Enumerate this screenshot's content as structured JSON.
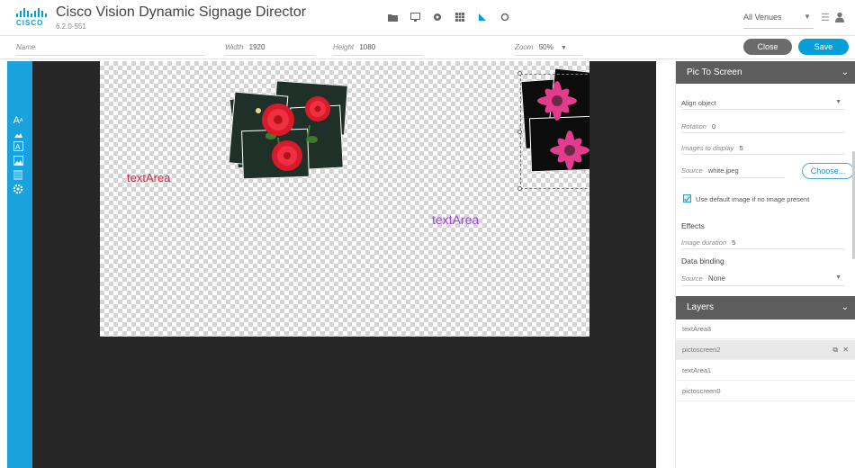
{
  "header": {
    "app_title": "Cisco Vision Dynamic Signage Director",
    "version": "6.2.0-551",
    "logo_word": "CISCO",
    "venue_select": "All Venues",
    "toolbar_icons": [
      "folder-icon",
      "monitor-icon",
      "gear-icon",
      "grid-icon",
      "pointer-icon",
      "settings-icon"
    ]
  },
  "properties": {
    "name_label": "Name",
    "name_value": "",
    "width_label": "Width",
    "width_value": "1920",
    "height_label": "Height",
    "height_value": "1080",
    "zoom_label": "Zoom",
    "zoom_value": "50%",
    "close_label": "Close",
    "save_label": "Save"
  },
  "left_tools": [
    "text-tool-icon",
    "image-tool-icon",
    "ticker-tool-icon",
    "picture-tool-icon",
    "list-tool-icon",
    "settings-tool-icon"
  ],
  "canvas": {
    "text_area_1": "textArea",
    "text_area_3": "textArea"
  },
  "panel": {
    "title": "Pic To Screen",
    "align_label": "Align object",
    "rotation_label": "Rotation",
    "rotation_value": "0",
    "images_label": "Images to display",
    "images_value": "5",
    "source_label": "Source",
    "source_value": "white.jpeg",
    "choose_label": "Choose...",
    "default_image_label": "Use default image if no image present",
    "default_image_checked": true,
    "effects_label": "Effects",
    "duration_label": "Image duration",
    "duration_value": "5",
    "data_binding_label": "Data binding",
    "binding_source_label": "Source",
    "binding_source_value": "None"
  },
  "layers": {
    "title": "Layers",
    "items": [
      "textArea3",
      "pictoscreen2",
      "textArea1",
      "pictoscreen0"
    ],
    "active_index": 1
  },
  "colors": {
    "accent": "#049fd9",
    "text_area_1": "#e0233c",
    "text_area_3": "#a23fd8",
    "panel_header": "#5d5d5d",
    "workspace": "#262626"
  }
}
